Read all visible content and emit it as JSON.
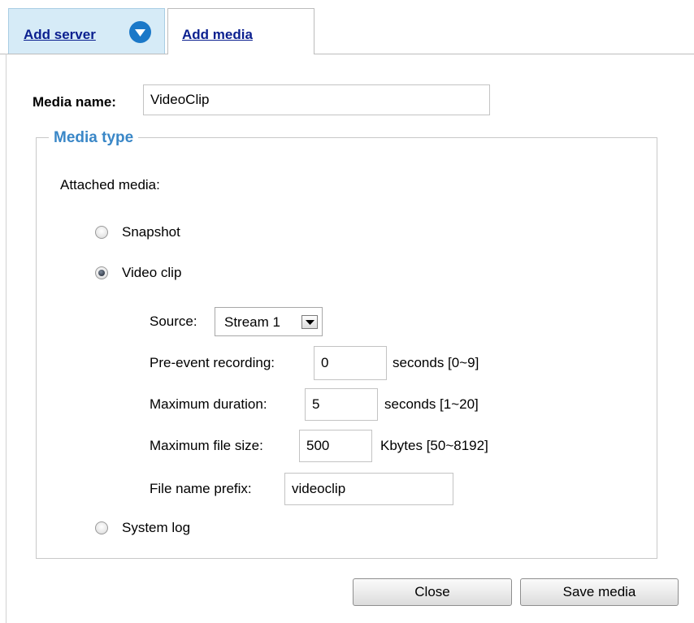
{
  "tabs": {
    "add_server": "Add server",
    "add_media": "Add media"
  },
  "media_name": {
    "label": "Media name:",
    "value": "VideoClip"
  },
  "media_type": {
    "legend": "Media type",
    "attached_label": "Attached media:",
    "options": {
      "snapshot": "Snapshot",
      "video_clip": "Video clip",
      "system_log": "System log"
    },
    "selected": "video_clip"
  },
  "video_clip": {
    "source_label": "Source:",
    "source_value": "Stream 1",
    "pre_event_label": "Pre-event recording:",
    "pre_event_value": "0",
    "pre_event_unit": "seconds [0~9]",
    "max_duration_label": "Maximum duration:",
    "max_duration_value": "5",
    "max_duration_unit": "seconds [1~20]",
    "max_file_size_label": "Maximum file size:",
    "max_file_size_value": "500",
    "max_file_size_unit": "Kbytes [50~8192]",
    "file_prefix_label": "File name prefix:",
    "file_prefix_value": "videoclip"
  },
  "buttons": {
    "close": "Close",
    "save_media": "Save media"
  },
  "colors": {
    "tab_active_bg": "#d6ebf7",
    "link": "#0a1f8f",
    "legend": "#3a87c7",
    "chevron": "#1b78c8"
  },
  "icons": {
    "tab_dropdown": "chevron-down-circle-icon",
    "select_arrow": "triangle-down-icon"
  }
}
